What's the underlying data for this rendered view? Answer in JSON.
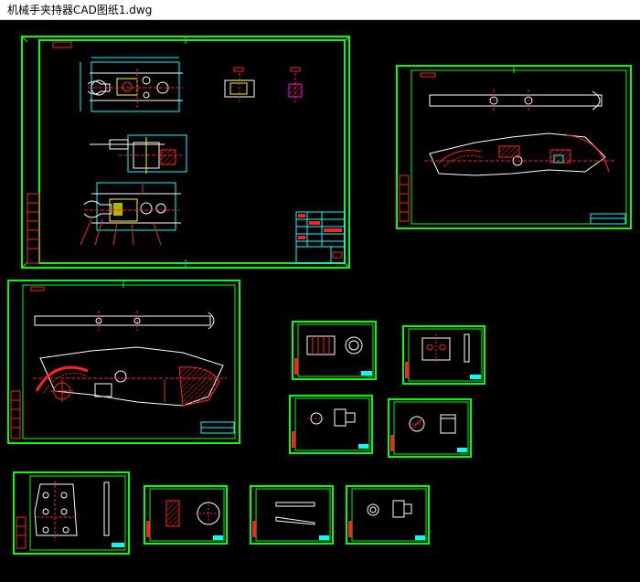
{
  "window": {
    "title": "机械手夹持器CAD图纸1.dwg"
  },
  "colors": {
    "background": "#000000",
    "border": "#00ff00",
    "line": "#ffffff",
    "cyan": "#00ffff",
    "red": "#ff2020",
    "yellow": "#ffff00",
    "magenta": "#ff00ff"
  }
}
